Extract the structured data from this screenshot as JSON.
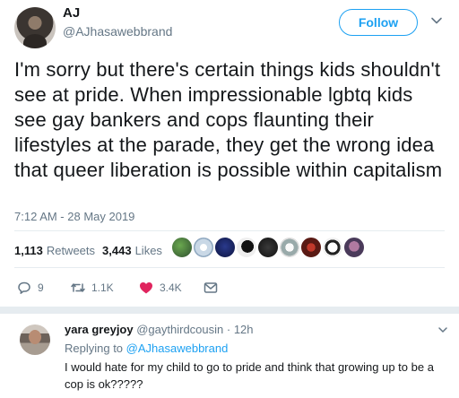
{
  "tweet": {
    "display_name": "AJ",
    "handle": "@AJhasawebbrand",
    "follow_label": "Follow",
    "text": "I'm sorry but there's certain things kids shouldn't see at pride. When impressionable lgbtq kids see gay bankers and cops flaunting their lifestyles at the parade, they get the wrong idea that queer liberation is possible within capitalism",
    "timestamp": "7:12 AM - 28 May 2019",
    "retweets_count": "1,113",
    "retweets_label": "Retweets",
    "likes_count": "3,443",
    "likes_label": "Likes"
  },
  "actions": {
    "reply_count": "9",
    "retweet_count": "1.1K",
    "like_count": "3.4K"
  },
  "reply": {
    "display_name": "yara greyjoy",
    "handle": "@gaythirdcousin",
    "time": "· 12h",
    "replying_prefix": "Replying to",
    "replying_mention": "@AJhasawebbrand",
    "text": "I would hate for my child to go to pride and think that growing up to be a cop is ok?????"
  },
  "colors": {
    "accent": "#1da1f2",
    "like_red": "#e0245e",
    "retweet_green": "#17bf63",
    "muted": "#657786"
  }
}
